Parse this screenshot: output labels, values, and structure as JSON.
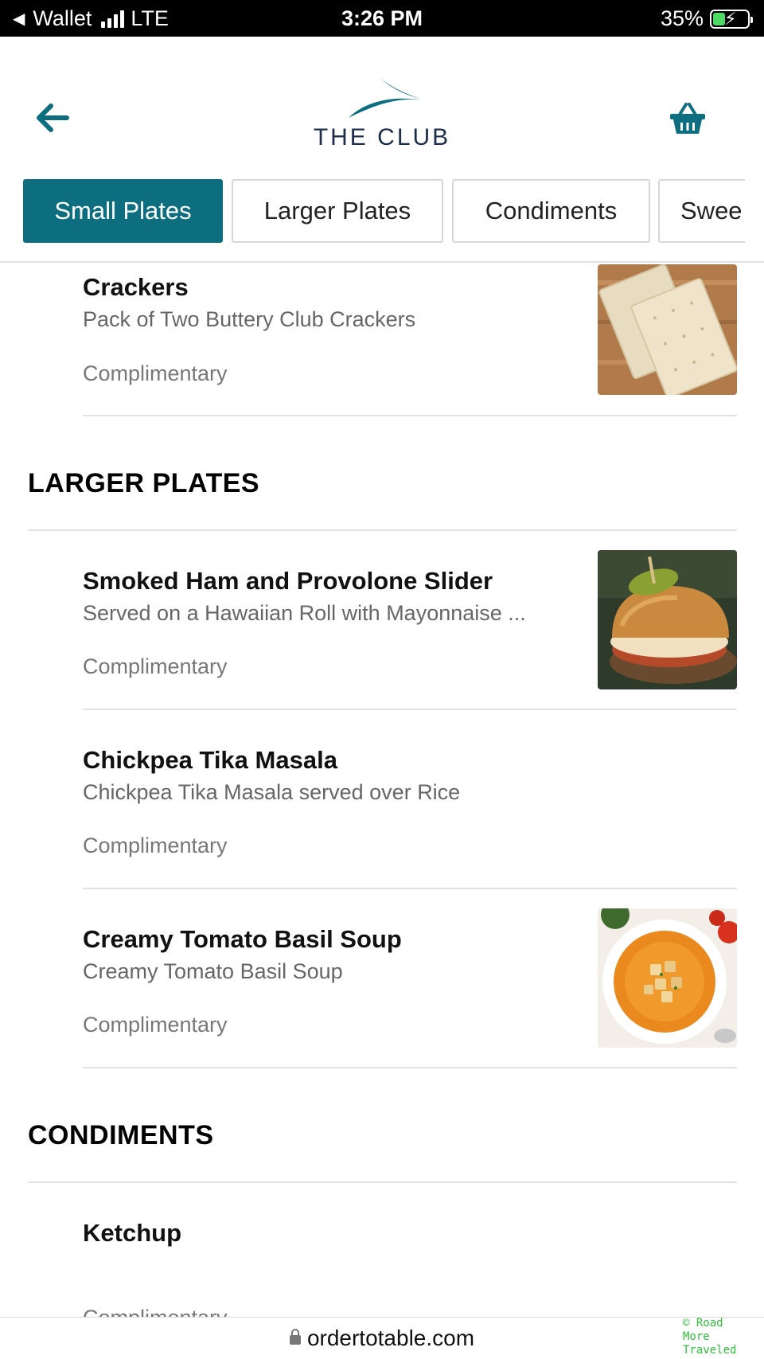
{
  "status_bar": {
    "back_app": "Wallet",
    "network": "LTE",
    "time": "3:26 PM",
    "battery": "35%",
    "battery_level": 0.35
  },
  "header": {
    "logo_text": "THE CLUB",
    "brand_color": "#0d6e80"
  },
  "tabs": [
    {
      "label": "Small Plates",
      "active": true
    },
    {
      "label": "Larger Plates",
      "active": false
    },
    {
      "label": "Condiments",
      "active": false
    },
    {
      "label": "Swee",
      "active": false
    }
  ],
  "small_plates_items": [
    {
      "title": "Crackers",
      "description": "Pack of Two Buttery Club Crackers",
      "price": "Complimentary",
      "image": "crackers-photo"
    }
  ],
  "sections": {
    "larger_plates": "LARGER PLATES",
    "condiments": "CONDIMENTS"
  },
  "larger_plates_items": [
    {
      "title": "Smoked Ham and Provolone Slider",
      "description": "Served on a Hawaiian Roll with Mayonnaise ...",
      "price": "Complimentary",
      "image": "slider-photo"
    },
    {
      "title": "Chickpea Tika Masala",
      "description": "Chickpea Tika Masala served over Rice",
      "price": "Complimentary"
    },
    {
      "title": "Creamy Tomato Basil Soup",
      "description": "Creamy Tomato Basil Soup",
      "price": "Complimentary",
      "image": "soup-photo"
    }
  ],
  "condiments_items": [
    {
      "title": "Ketchup",
      "price": "Complimentary"
    }
  ],
  "url_bar": {
    "url": "ordertotable.com"
  },
  "watermark": {
    "line1": "© Road",
    "line2": "More",
    "line3": "Traveled"
  }
}
